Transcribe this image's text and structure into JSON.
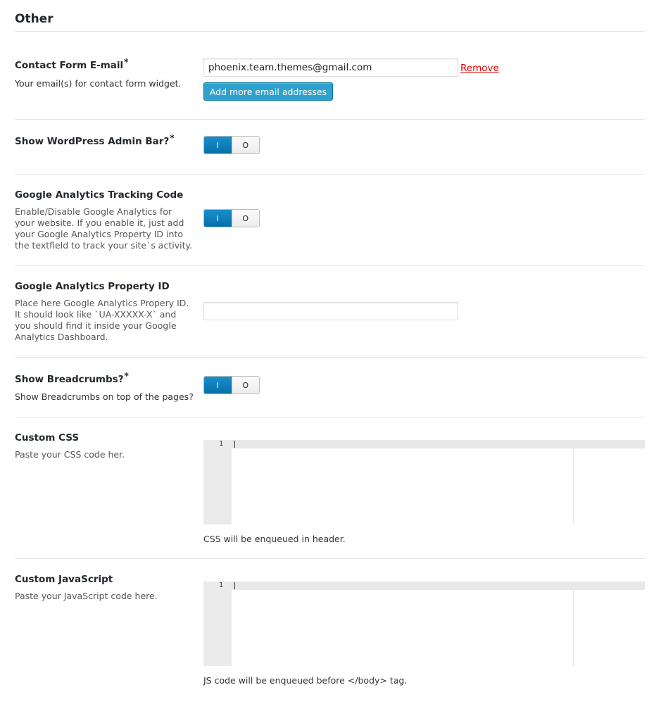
{
  "section": {
    "title": "Other"
  },
  "contact_email": {
    "label": "Contact Form E-mail",
    "required_mark": "*",
    "description": "Your email(s) for contact form widget.",
    "value": "phoenix.team.themes@gmail.com",
    "remove_label": "Remove",
    "add_more_label": "Add more email addresses"
  },
  "admin_bar": {
    "label": "Show WordPress Admin Bar?",
    "required_mark": "*",
    "on_label": "I",
    "off_label": "O",
    "state": "on"
  },
  "ga_tracking": {
    "label": "Google Analytics Tracking Code",
    "description": "Enable/Disable Google Analytics for your website. If you enable it, just add your Google Analytics Property ID into the textfield to track your site`s activity.",
    "on_label": "I",
    "off_label": "O",
    "state": "on"
  },
  "ga_property": {
    "label": "Google Analytics Property ID",
    "description": "Place here Google Analytics Propery ID. It should look like `UA-XXXXX-X` and you should find it inside your Google Analytics Dashboard.",
    "value": ""
  },
  "breadcrumbs": {
    "label": "Show Breadcrumbs?",
    "required_mark": "*",
    "description": "Show Breadcrumbs on top of the pages?",
    "on_label": "I",
    "off_label": "O",
    "state": "on"
  },
  "custom_css": {
    "label": "Custom CSS",
    "description": "Paste your CSS code her.",
    "line_number": "1",
    "note": "CSS will be enqueued in header."
  },
  "custom_js": {
    "label": "Custom JavaScript",
    "description": "Paste your JavaScript code here.",
    "line_number": "1",
    "note": "JS code will be enqueued before </body> tag."
  },
  "colors": {
    "toggle_on": "#0a78b4",
    "button": "#2ea2cc",
    "remove_link": "#dd0000"
  }
}
